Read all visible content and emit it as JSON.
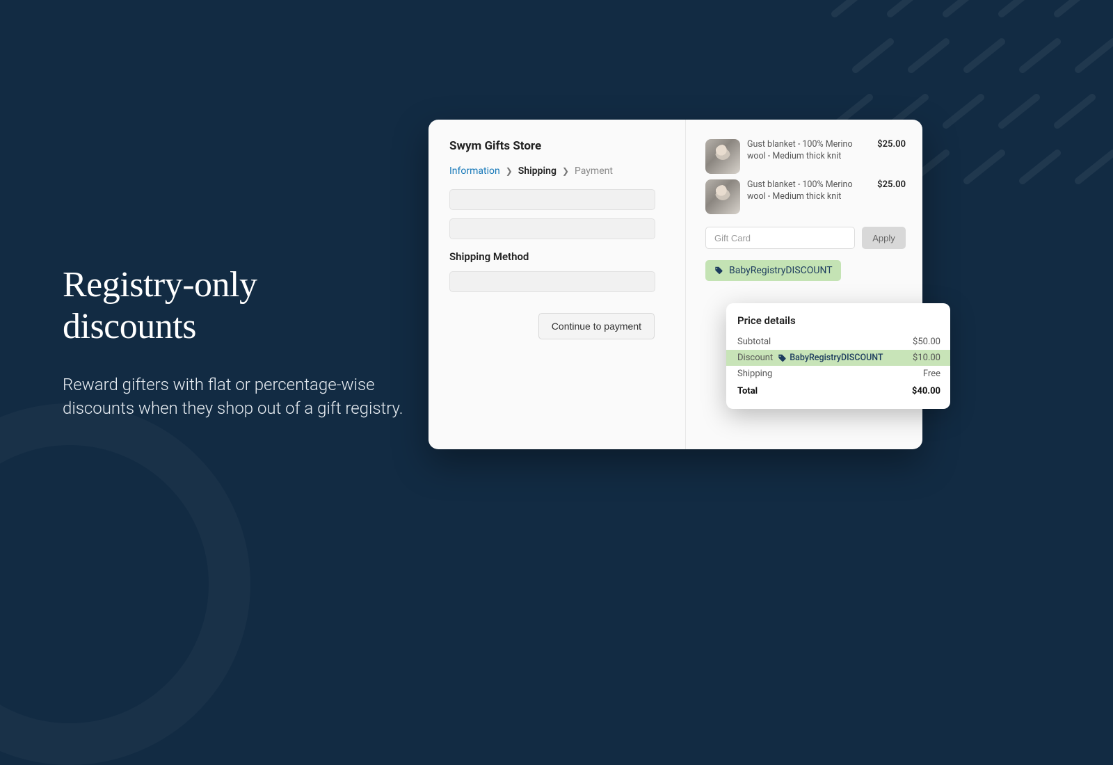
{
  "hero": {
    "title_l1": "Registry-only",
    "title_l2": "discounts",
    "subtitle": "Reward gifters with flat or percentage-wise discounts when they shop out of a gift registry."
  },
  "checkout": {
    "store_name": "Swym Gifts Store",
    "breadcrumb": {
      "information": "Information",
      "shipping": "Shipping",
      "payment": "Payment"
    },
    "shipping_method_label": "Shipping Method",
    "continue_label": "Continue to payment"
  },
  "cart": {
    "items": [
      {
        "name": "Gust blanket - 100% Merino wool - Medium thick knit",
        "price": "$25.00"
      },
      {
        "name": "Gust blanket - 100% Merino wool - Medium thick knit",
        "price": "$25.00"
      }
    ],
    "gift_card_placeholder": "Gift Card",
    "apply_label": "Apply",
    "discount_code": "BabyRegistryDISCOUNT"
  },
  "price_details": {
    "title": "Price details",
    "subtotal_label": "Subtotal",
    "subtotal_value": "$50.00",
    "discount_label": "Discount",
    "discount_code": "BabyRegistryDISCOUNT",
    "discount_value": "$10.00",
    "shipping_label": "Shipping",
    "shipping_value": "Free",
    "total_label": "Total",
    "total_value": "$40.00"
  }
}
